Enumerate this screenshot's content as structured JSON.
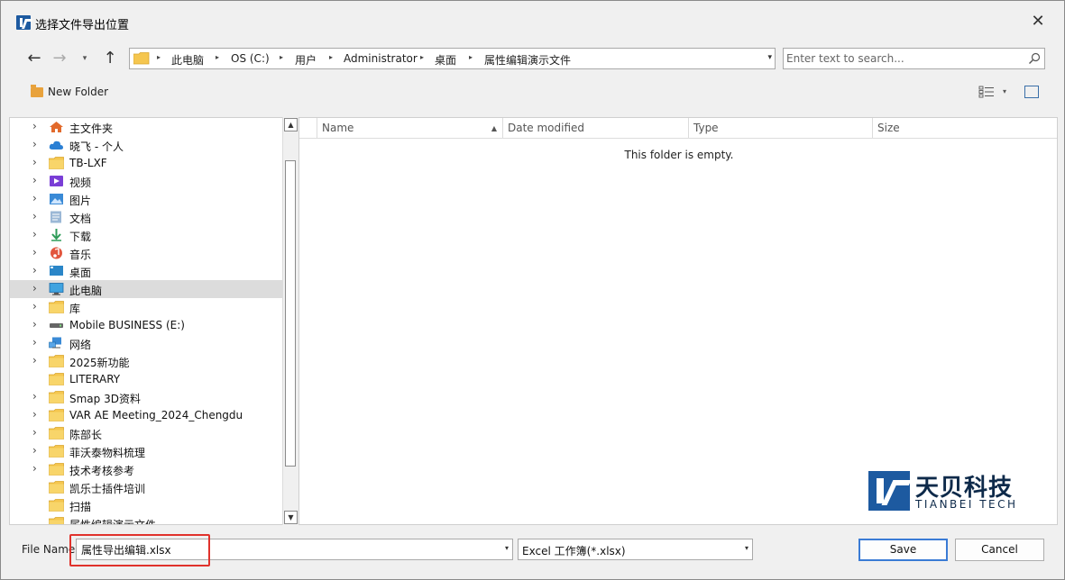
{
  "window": {
    "title": "选择文件导出位置",
    "close_symbol": "✕"
  },
  "nav": {
    "back_symbol": "←",
    "forward_symbol": "→",
    "recent_symbol": "▾",
    "up_symbol": "↑"
  },
  "address": {
    "crumbs": [
      "此电脑",
      "OS (C:)",
      "用户",
      "Administrator",
      "桌面",
      "属性编辑演示文件"
    ],
    "separator_symbol": "▸",
    "dropdown_symbol": "▾"
  },
  "search": {
    "placeholder": "Enter text to search..."
  },
  "toolbar": {
    "new_folder_label": "New Folder"
  },
  "tree": {
    "items": [
      {
        "label": "主文件夹",
        "icon": "home-icon",
        "expandable": true
      },
      {
        "label": "晓飞 - 个人",
        "icon": "cloud-icon",
        "expandable": true
      },
      {
        "label": "TB-LXF",
        "icon": "folder-icon",
        "expandable": true
      },
      {
        "label": "视频",
        "icon": "video-icon",
        "expandable": true
      },
      {
        "label": "图片",
        "icon": "pictures-icon",
        "expandable": true
      },
      {
        "label": "文档",
        "icon": "documents-icon",
        "expandable": true
      },
      {
        "label": "下载",
        "icon": "download-icon",
        "expandable": true
      },
      {
        "label": "音乐",
        "icon": "music-icon",
        "expandable": true
      },
      {
        "label": "桌面",
        "icon": "desktop-icon",
        "expandable": true
      },
      {
        "label": "此电脑",
        "icon": "computer-icon",
        "expandable": true,
        "selected": true
      },
      {
        "label": "库",
        "icon": "folder-icon",
        "expandable": true
      },
      {
        "label": "Mobile BUSINESS (E:)",
        "icon": "drive-icon",
        "expandable": true
      },
      {
        "label": "网络",
        "icon": "network-icon",
        "expandable": true
      },
      {
        "label": "2025新功能",
        "icon": "folder-icon",
        "expandable": true
      },
      {
        "label": "LITERARY",
        "icon": "folder-icon",
        "expandable": false
      },
      {
        "label": "Smap 3D资料",
        "icon": "folder-icon",
        "expandable": true
      },
      {
        "label": "VAR AE Meeting_2024_Chengdu",
        "icon": "folder-icon",
        "expandable": true
      },
      {
        "label": "陈部长",
        "icon": "folder-icon",
        "expandable": true
      },
      {
        "label": "菲沃泰物料梳理",
        "icon": "folder-icon",
        "expandable": true
      },
      {
        "label": "技术考核参考",
        "icon": "folder-icon",
        "expandable": true
      },
      {
        "label": "凯乐士插件培训",
        "icon": "folder-icon",
        "expandable": false
      },
      {
        "label": "扫描",
        "icon": "folder-icon",
        "expandable": false
      },
      {
        "label": "属性编辑演示文件",
        "icon": "folder-icon",
        "expandable": false
      }
    ]
  },
  "filelist": {
    "columns": [
      "Name",
      "Date modified",
      "Type",
      "Size"
    ],
    "sort_symbol": "▲",
    "empty_message": "This folder is empty."
  },
  "watermark": {
    "name_cn": "天贝科技",
    "name_en": "TIANBEI TECH"
  },
  "footer": {
    "file_name_label": "File Name",
    "file_name_value": "属性导出编辑.xlsx",
    "file_type_value": "Excel 工作簿(*.xlsx)",
    "dropdown_symbol": "▾",
    "save_label": "Save",
    "cancel_label": "Cancel"
  },
  "colors": {
    "accent": "#1d5aa0",
    "highlight": "#e0322c",
    "selected_row": "#dcdcdc",
    "folder": "#f5c64f"
  }
}
